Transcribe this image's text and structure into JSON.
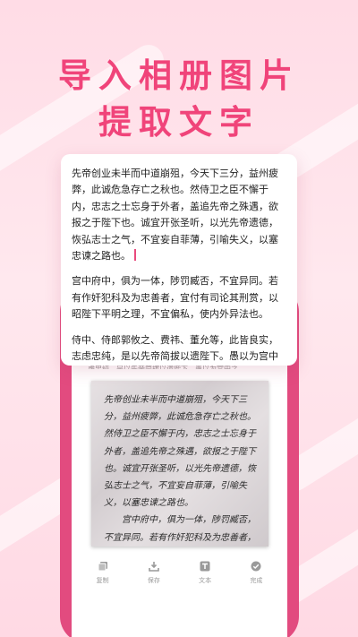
{
  "headline": {
    "line1": "导入相册图片",
    "line2": "提取文字"
  },
  "result_card": {
    "paragraphs": [
      "先帝创业未半而中道崩殂，今天下三分，益州疲弊，此诚危急存亡之秋也。然侍卫之臣不懈于内，忠志之士忘身于外者，盖追先帝之殊遇，欲报之于陛下也。诚宜开张圣听，以光先帝遗德，恢弘志士之气，不宜妄自菲薄，引喻失义，以塞忠谏之路也。",
      "宫中府中，俱为一体，陟罚臧否，不宜异同。若有作奸犯科及为忠善者，宜付有司论其刑赏，以昭陛下平明之理，不宜偏私，使内外异法也。",
      "侍中、侍郎郭攸之、费祎、董允等，此皆良实，志虑忠纯，是以先帝简拔以遗陛下。愚以为宫中之"
    ]
  },
  "photo": {
    "paragraphs": [
      "先帝创业未半而中道崩殂，今天下三分，益州疲弊，此诚危急存亡之秋也。然侍卫之臣不懈于内，忠志之士忘身于外者，盖追先帝之殊遇，欲报之于陛下也。诚宜开张圣听，以光先帝遗德，恢弘志士之气，不宜妄自菲薄，引喻失义，以塞忠谏之路也。",
      "宫中府中，俱为一体，陟罚臧否，不宜异同。若有作奸犯科及为忠善者，宜付有司论其刑赏，以昭陛下平明之理，不宜偏私，使内外异法也。"
    ]
  },
  "strip_text": "虑忠纯，是以先帝简拔以遗陛下。愚以为宫中之",
  "tabbar": {
    "items": [
      {
        "label": "复制",
        "icon": "copy-icon"
      },
      {
        "label": "保存",
        "icon": "download-icon"
      },
      {
        "label": "文本",
        "icon": "text-icon"
      },
      {
        "label": "完成",
        "icon": "check-icon"
      }
    ]
  },
  "colors": {
    "accent": "#f0447a",
    "phone_frame": "#e24b7f",
    "background": "#ffdce6"
  }
}
